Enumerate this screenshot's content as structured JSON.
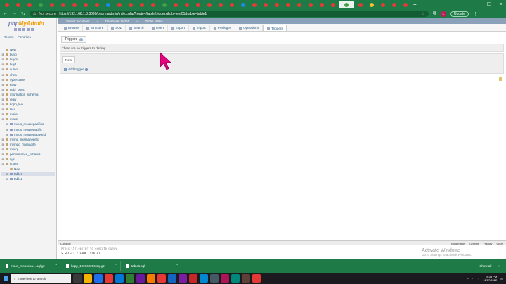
{
  "browser": {
    "tab_favicon_colors": [
      "#e53935",
      "#e53935",
      "#e53935",
      "#43a047",
      "#e53935",
      "#e53935",
      "#e53935",
      "#e53935",
      "#e53935",
      "#1e88e5",
      "#e53935",
      "#e53935",
      "#e53935",
      "#e53935",
      "#43a047",
      "#e53935",
      "#e53935",
      "#e53935",
      "#e53935",
      "#e53935",
      "#e53935",
      "#1e88e5",
      "#e53935",
      "#e53935",
      "#e53935",
      "#e53935",
      "#e53935",
      "#e53935",
      "#e53935",
      "#e53935",
      "#43a047",
      "#e53935",
      "#fbc02d",
      "#e53935",
      "#e53935",
      "#e53935"
    ],
    "secure_label": "Not secure",
    "url": "https://192.168.1.3:8090/phpmyadmin/index.php?route=/table/triggers&db=test01&table=table1",
    "profile_initial": "L",
    "update_label": "Update"
  },
  "sidebar": {
    "logo_main": "php",
    "logo_accent": "MyAdmin",
    "links": [
      "Recent",
      "Favorites"
    ],
    "tree": [
      {
        "label": "New",
        "level": 0,
        "kind": "new"
      },
      {
        "label": "buyb",
        "level": 0,
        "kind": "db"
      },
      {
        "label": "buym",
        "level": 0,
        "kind": "db"
      },
      {
        "label": "buy1",
        "level": 0,
        "kind": "db"
      },
      {
        "label": "cumo",
        "level": 0,
        "kind": "db"
      },
      {
        "label": "chea",
        "level": 0,
        "kind": "db"
      },
      {
        "label": "cyberpanel",
        "level": 0,
        "kind": "db"
      },
      {
        "label": "easy",
        "level": 0,
        "kind": "db"
      },
      {
        "label": "gubi_pocs",
        "level": 0,
        "kind": "db"
      },
      {
        "label": "information_schema",
        "level": 0,
        "kind": "db"
      },
      {
        "label": "iegw",
        "level": 0,
        "kind": "db"
      },
      {
        "label": "kdpp_live",
        "level": 0,
        "kind": "db"
      },
      {
        "label": "laci",
        "level": 0,
        "kind": "db"
      },
      {
        "label": "maile",
        "level": 0,
        "kind": "db"
      },
      {
        "label": "mous",
        "level": 0,
        "kind": "db"
      },
      {
        "label": "mous_mousepacifius",
        "level": 1,
        "kind": "table"
      },
      {
        "label": "mous_mousepacific",
        "level": 1,
        "kind": "table"
      },
      {
        "label": "mous_mousepacworld",
        "level": 1,
        "kind": "table"
      },
      {
        "label": "myma_mismanepific",
        "level": 0,
        "kind": "db"
      },
      {
        "label": "mymag_mymagife",
        "level": 0,
        "kind": "db"
      },
      {
        "label": "mysql",
        "level": 0,
        "kind": "db"
      },
      {
        "label": "performance_schema",
        "level": 0,
        "kind": "db"
      },
      {
        "label": "sys",
        "level": 0,
        "kind": "db"
      },
      {
        "label": "test01",
        "level": 0,
        "kind": "db"
      },
      {
        "label": "New",
        "level": 1,
        "kind": "new"
      },
      {
        "label": "table1",
        "level": 1,
        "kind": "table",
        "selected": true
      },
      {
        "label": "table2",
        "level": 1,
        "kind": "table"
      }
    ]
  },
  "breadcrumb": [
    "Server: localhost",
    "Database: test01",
    "Table: table1"
  ],
  "tabs": [
    {
      "label": "Browse",
      "active": false
    },
    {
      "label": "Structure",
      "active": false
    },
    {
      "label": "SQL",
      "active": false
    },
    {
      "label": "Search",
      "active": false
    },
    {
      "label": "Insert",
      "active": false
    },
    {
      "label": "Export",
      "active": false
    },
    {
      "label": "Import",
      "active": false
    },
    {
      "label": "Privileges",
      "active": false
    },
    {
      "label": "Operations",
      "active": false
    },
    {
      "label": "Triggers",
      "active": true
    }
  ],
  "content": {
    "section_title": "Triggers",
    "empty_message": "There are no triggers to display.",
    "new_legend": "New",
    "add_trigger": "Add trigger"
  },
  "console": {
    "label": "Console",
    "actions": [
      "Bookmarks",
      "Options",
      "History",
      "Clear"
    ],
    "hint": "Press Ctrl+Enter to execute query",
    "last_query": "> SELECT * FROM `table1`"
  },
  "watermark": {
    "title": "Activate Windows",
    "subtitle": "Go to Settings to activate Windows."
  },
  "downloads": {
    "items": [
      "mous_mousepa....sql.gz",
      "kdpp_192169206.sql.gz",
      "table1.sql"
    ],
    "show_all": "Show all",
    "close": "×"
  },
  "taskbar": {
    "search_placeholder": "Type here to search",
    "app_colors": [
      "#3a3a3a",
      "#f2b400",
      "#1f6feb",
      "#e53935",
      "#0078d4",
      "#2e7d32",
      "#6a1b9a",
      "#f57c00",
      "#e53935",
      "#1565c0",
      "#7b1fa2",
      "#c62828",
      "#0288d1",
      "#455a64",
      "#ad1457",
      "#00897b",
      "#5d4037",
      "#e53935"
    ],
    "time": "8:35 PM",
    "date": "11/17/2022"
  },
  "colors": {
    "chrome_green": "#1e7b47",
    "pma_link": "#235a81",
    "cursor_pink": "#e6007e"
  }
}
